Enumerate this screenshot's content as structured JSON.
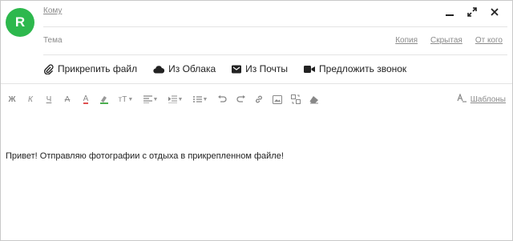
{
  "avatar": {
    "letter": "R",
    "color": "#2db84d"
  },
  "fields": {
    "to_label": "Кому",
    "subject_label": "Тема"
  },
  "recipients": {
    "cc": "Копия",
    "bcc": "Скрытая",
    "from": "От кого"
  },
  "attach": {
    "file": "Прикрепить файл",
    "cloud": "Из Облака",
    "mail": "Из Почты",
    "call": "Предложить звонок"
  },
  "toolbar": {
    "bold": "Ж",
    "italic": "К",
    "underline": "Ч",
    "strike": "А",
    "color": "А",
    "size": "тТ"
  },
  "templates_label": "Шаблоны",
  "message_body": "Привет! Отправляю фотографии с отдыха в прикрепленном файле!"
}
